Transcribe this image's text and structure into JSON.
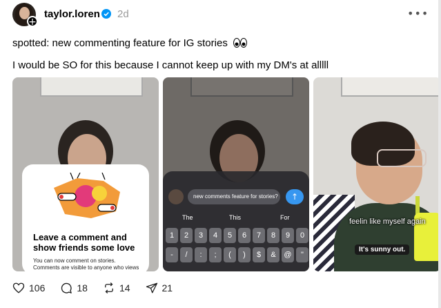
{
  "post": {
    "username": "taylor.loren",
    "time": "2d",
    "caption_line1": "spotted: new commenting feature for IG stories",
    "caption_line2": "I would be SO for this because I cannot keep up with my DM's at alllll"
  },
  "media": [
    {
      "card_title": "Leave a comment and show friends some love",
      "card_body": "You can now comment on stories. Comments are visible to anyone who views the story."
    },
    {
      "input_text": "new comments feature for stories?",
      "suggestions": [
        "The",
        "This",
        "For"
      ],
      "row_digits": [
        "1",
        "2",
        "3",
        "4",
        "5",
        "6",
        "7",
        "8",
        "9",
        "0"
      ],
      "row_symbols": [
        "-",
        "/",
        ":",
        ";",
        "(",
        ")",
        "$",
        "&",
        "@",
        "\""
      ]
    },
    {
      "subtitle": "feelin like myself again",
      "sticker_text": "It's sunny out."
    }
  ],
  "actions": {
    "likes": "106",
    "comments": "18",
    "reposts": "14",
    "shares": "21"
  },
  "colors": {
    "verified": "#0095f6",
    "send_button": "#3797f0",
    "sticker_accent": "#e8f03a"
  },
  "icons": [
    "verified-badge-icon",
    "more-icon",
    "heart-icon",
    "comment-icon",
    "repost-icon",
    "share-icon",
    "eyes-emoji-icon",
    "send-arrow-icon",
    "plus-icon"
  ]
}
